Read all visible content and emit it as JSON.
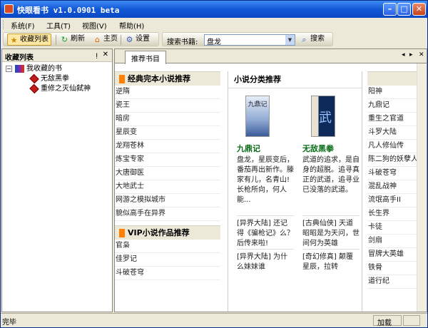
{
  "window": {
    "title": "快眼看书 v1.0.0901 beta",
    "min": "–",
    "max": "□",
    "close": "✕"
  },
  "menu": [
    "系统(F)",
    "工具(T)",
    "视图(V)",
    "帮助(H)"
  ],
  "toolbar": {
    "favorites": "收藏列表",
    "refresh": "刷新",
    "home": "主页",
    "settings": "设置",
    "search_label": "搜索书籍:",
    "search_value": "盘龙",
    "search_button": "搜索"
  },
  "left_panel": {
    "title": "收藏列表",
    "pin": "ᴉ",
    "close": "✕",
    "root": "我收藏的书",
    "items": [
      "无敌黑拳",
      "重修之灭仙弑神"
    ]
  },
  "tabs": {
    "active": "推荐书目",
    "prev": "◂",
    "next": "▸",
    "close": "✕"
  },
  "col1": {
    "head1": "经典完本小说推荐",
    "list1": [
      "逆隋",
      "瓷王",
      "暗房",
      "星辰变",
      "龙翔苍林",
      "炼宝专家",
      "大唐御医",
      "大地武士",
      "网游之模拟城市",
      "貌似高手在异界"
    ],
    "head2": "VIP小说作品推荐",
    "list2": [
      "官枭",
      "佳罗记",
      "斗破苍穹"
    ]
  },
  "col2": {
    "head": "小说分类推荐",
    "books": [
      {
        "title": "九鼎记",
        "desc": "盘龙，星辰变后，番茄再出新作。滕家有儿，名青山!长枪所向，何人能...",
        "snippets": [
          "[异界大陆] 还记得《骗枪记》么？后传来啦!",
          "[异界大陆] 为什么妹妹谁"
        ],
        "cover_text": "九鼎记"
      },
      {
        "title": "无敌黑拳",
        "desc": "武道的追求，是自身的超脱。追寻真正的武道，追寻业已没落的武道。",
        "snippets": [
          "[古典仙侠] 天道昭昭是为天问，世间何为英雄",
          "[奇幻修真] 颠覆星辰，拉转"
        ],
        "cover_text": "武"
      }
    ]
  },
  "col3": {
    "list": [
      "阳神",
      "九鼎记",
      "重生之官道",
      "斗罗大陆",
      "凡人修仙传",
      "陈二狗的妖孽人生",
      "斗破苍穹",
      "混乱战神",
      "流氓高手II",
      "长生界",
      "卡徒",
      "剑扇",
      "冒牌大英雄",
      "铁骨",
      "道行纪"
    ]
  },
  "status": {
    "text": "完毕",
    "cell1": "加载",
    "cell2": ""
  }
}
